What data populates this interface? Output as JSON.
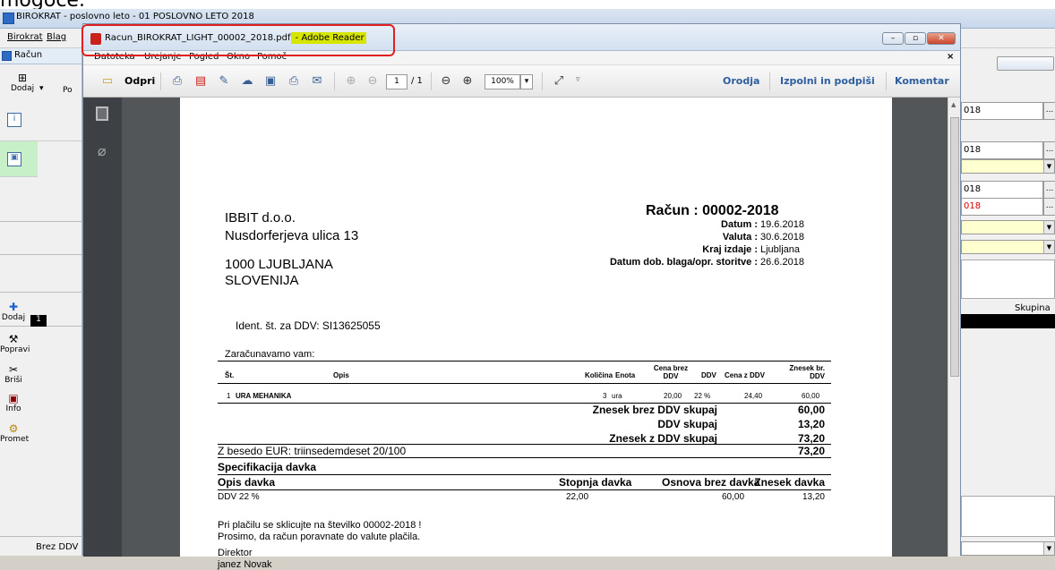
{
  "caption": "mogoče.",
  "app": {
    "title": "BIROKRAT - poslovno leto - 01 POSLOVNO LETO 2018",
    "menu": [
      "Birokrat",
      "Blag"
    ]
  },
  "left": {
    "window": "Račun",
    "add": "Dodaj",
    "po": "Po",
    "tools": [
      "Dodaj",
      "Popravi",
      "Briši",
      "Info",
      "Promet"
    ],
    "row_num": "1",
    "footer": "Brez DDV"
  },
  "right": {
    "fields": [
      "018",
      "018",
      "018",
      "018"
    ],
    "col": "Skupina"
  },
  "reader": {
    "title": "Racun_BIROKRAT_LIGHT_00002_2018.pdf",
    "suffix": " - Adobe Reader",
    "menu": [
      "Datoteka",
      "Urejanje",
      "Pogled",
      "Okno",
      "Pomoč"
    ],
    "open": "Odpri",
    "page": "1",
    "pages": "/ 1",
    "zoom": "100%",
    "tools": "Orodja",
    "sign": "Izpolni in podpiši",
    "comment": "Komentar"
  },
  "invoice": {
    "company": "IBBIT d.o.o.",
    "street": "Nusdorferjeva ulica 13",
    "city": "1000 LJUBLJANA",
    "country": "SLOVENIJA",
    "title": "Račun : 00002-2018",
    "meta": [
      {
        "k": "Datum :",
        "v": "19.6.2018"
      },
      {
        "k": "Valuta :",
        "v": "30.6.2018"
      },
      {
        "k": "Kraj izdaje :",
        "v": "Ljubljana"
      },
      {
        "k": "Datum dob. blaga/opr. storitve :",
        "v": "26.6.2018"
      }
    ],
    "vat_id": "Ident. št. za DDV: SI13625055",
    "charge": "Zaračunavamo vam:",
    "head": {
      "st": "Št.",
      "opis": "Opis",
      "kol": "Količina",
      "enota": "Enota",
      "cena": "Cena brez DDV",
      "ddv": "DDV",
      "cena_ddv": "Cena z DDV",
      "znesek": "Znesek br. DDV"
    },
    "item": {
      "st": "1",
      "opis": "URA MEHANIKA",
      "kol": "3",
      "enota": "ura",
      "cena": "20,00",
      "ddv": "22 %",
      "cena_ddv": "24,40",
      "znesek": "60,00"
    },
    "totals": [
      {
        "k": "Znesek brez DDV skupaj",
        "v": "60,00"
      },
      {
        "k": "DDV skupaj",
        "v": "13,20"
      },
      {
        "k": "Znesek z DDV skupaj",
        "v": "73,20"
      }
    ],
    "words": "Z besedo EUR: triinsedemdeset 20/100",
    "words_val": "73,20",
    "spec": "Specifikacija davka",
    "spec_head": {
      "opis": "Opis davka",
      "stopnja": "Stopnja davka",
      "osnova": "Osnova brez davka",
      "znesek": "Znesek davka"
    },
    "spec_row": {
      "opis": "DDV 22 %",
      "stopnja": "22,00",
      "osnova": "60,00",
      "znesek": "13,20"
    },
    "note1": "Pri plačilu se sklicujte na številko 00002-2018 !",
    "note2": "Prosimo, da račun poravnate do valute plačila.",
    "role": "Direktor",
    "name": "janez Novak"
  }
}
